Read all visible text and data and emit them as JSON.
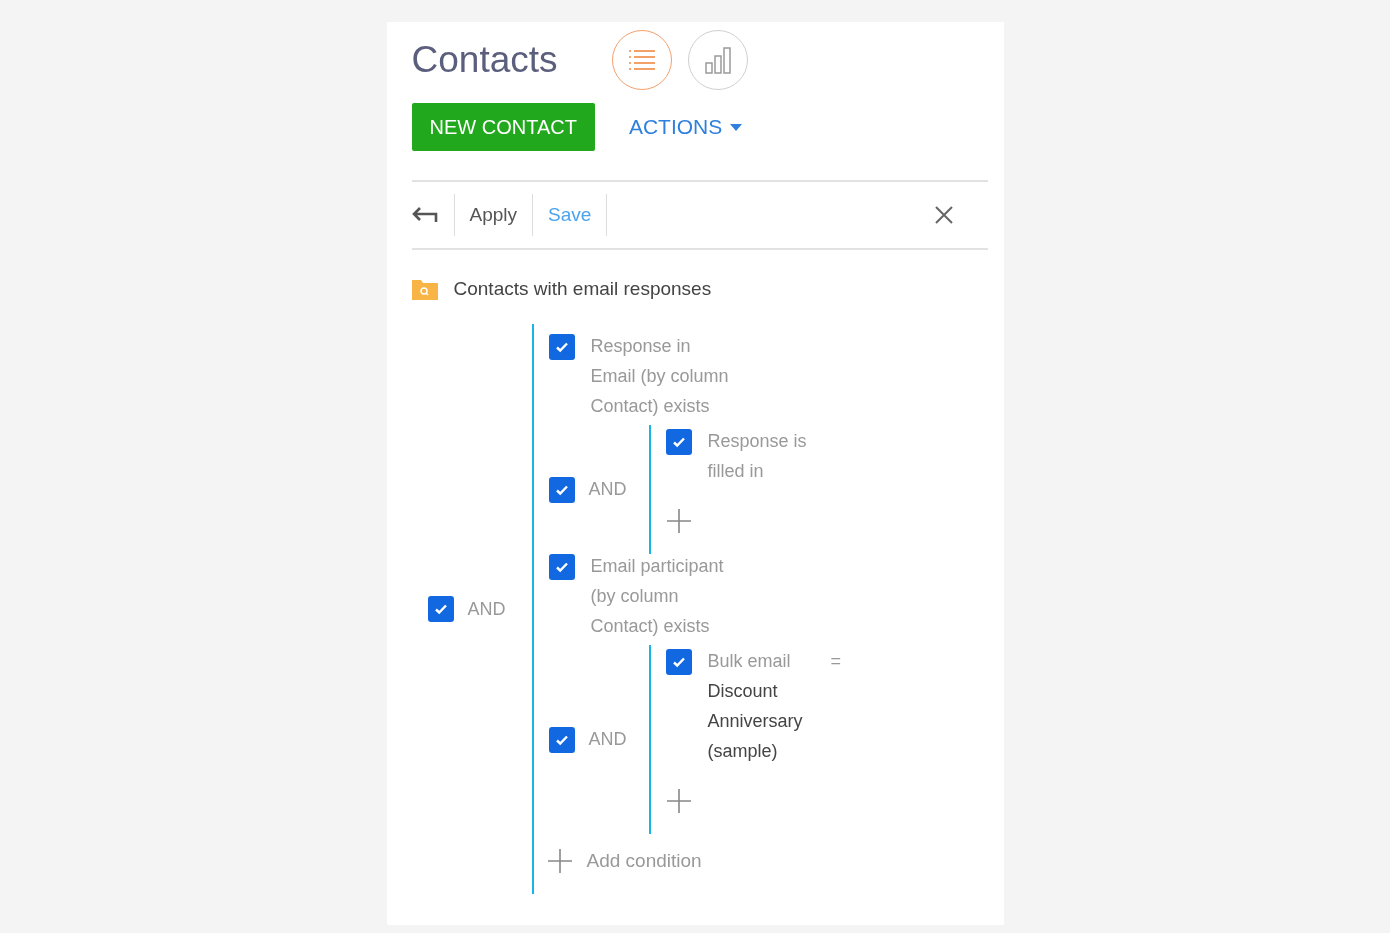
{
  "header": {
    "title": "Contacts",
    "views": [
      {
        "kind": "list",
        "selected": true
      },
      {
        "kind": "chart",
        "selected": false
      }
    ]
  },
  "actions": {
    "primary": "NEW CONTACT",
    "menu": "ACTIONS"
  },
  "filter_toolbar": {
    "apply": "Apply",
    "save": "Save"
  },
  "folder": {
    "name": "Contacts with email responses"
  },
  "filter": {
    "kind": "group",
    "checked": true,
    "operator": "AND",
    "add_label": "Add condition",
    "children": [
      {
        "kind": "condition",
        "checked": true,
        "column": "Response in Email (by column Contact)",
        "operator": "exists"
      },
      {
        "kind": "group",
        "checked": true,
        "operator": "AND",
        "children": [
          {
            "kind": "condition",
            "checked": true,
            "column": "Response",
            "operator": "is filled in"
          }
        ]
      },
      {
        "kind": "condition",
        "checked": true,
        "column": "Email participant (by column Contact)",
        "operator": "exists"
      },
      {
        "kind": "group",
        "checked": true,
        "operator": "AND",
        "children": [
          {
            "kind": "condition",
            "checked": true,
            "column": "Bulk email",
            "operator": "=",
            "value": "Discount Anniversary (sample)"
          }
        ]
      }
    ]
  }
}
